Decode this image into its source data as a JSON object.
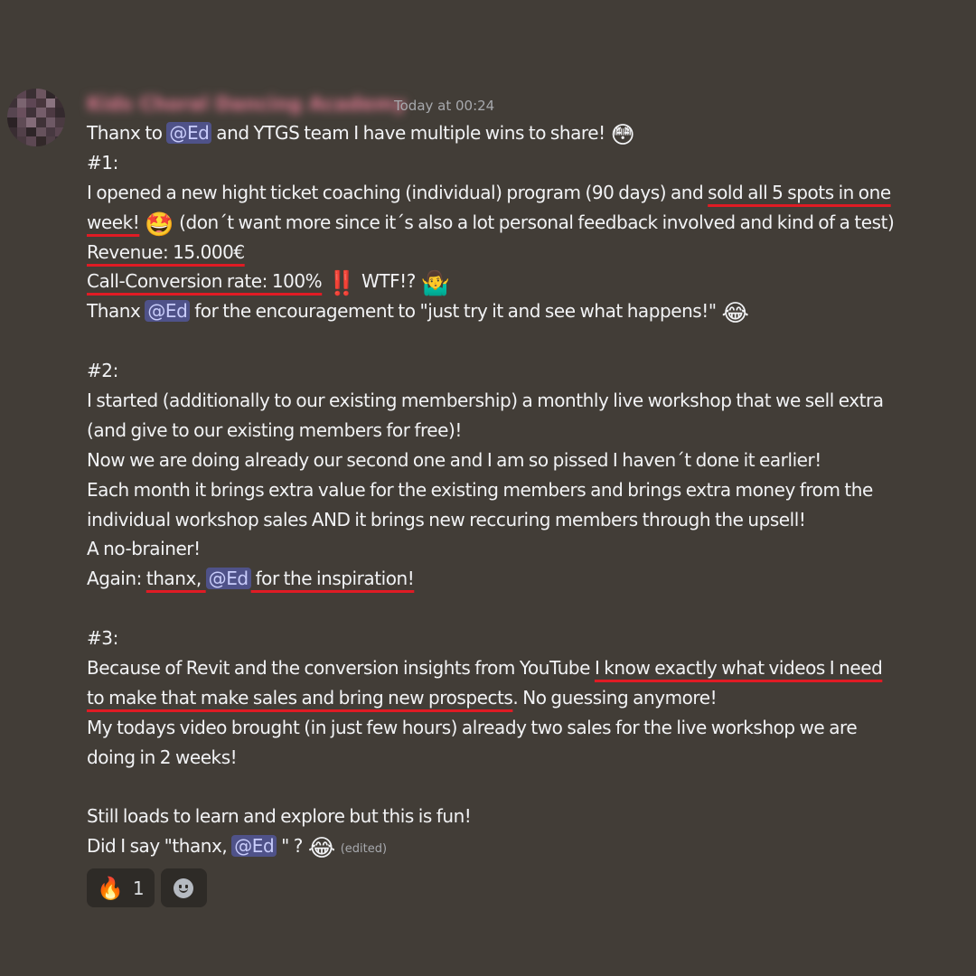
{
  "message": {
    "author": "Kids Choral Dancing Academy",
    "timestamp": "Today at 00:24",
    "lines": [
      [
        {
          "t": "Thanx to "
        },
        {
          "m": "@Ed"
        },
        {
          "t": " and YTGS team I have multiple wins to share! "
        },
        {
          "e": "😳"
        }
      ],
      [
        {
          "t": "#1:"
        }
      ],
      [
        {
          "t": "I opened a new hight ticket coaching (individual) program (90 days) and "
        },
        {
          "u": "sold all 5 spots in one"
        }
      ],
      [
        {
          "u": "week!"
        },
        {
          "t": " "
        },
        {
          "e": "🤩"
        },
        {
          "t": " (don´t want more since it´s also a lot personal feedback involved and kind of a test)"
        }
      ],
      [
        {
          "u": "Revenue: 15.000€"
        }
      ],
      [
        {
          "u": "Call-Conversion rate: 100%"
        },
        {
          "t": " "
        },
        {
          "e": "‼️"
        },
        {
          "t": " WTF!? "
        },
        {
          "e": "🤷‍♂️"
        }
      ],
      [
        {
          "t": "Thanx "
        },
        {
          "m": "@Ed"
        },
        {
          "t": " for the encouragement to \"just try it and see what happens!\" "
        },
        {
          "e": "😂"
        }
      ],
      [],
      [
        {
          "t": "#2:"
        }
      ],
      [
        {
          "t": "I started (additionally to our existing membership) a monthly live workshop that we sell extra"
        }
      ],
      [
        {
          "t": "(and give to our existing members for free)!"
        }
      ],
      [
        {
          "t": "Now we are doing already our second one and I am so pissed I haven´t done it earlier!"
        }
      ],
      [
        {
          "t": "Each month it brings extra value for the existing members and brings extra money from the"
        }
      ],
      [
        {
          "t": "individual workshop sales AND it brings new reccuring members through the upsell!"
        }
      ],
      [
        {
          "t": "A no-brainer!"
        }
      ],
      [
        {
          "t": "Again: "
        },
        {
          "u": "thanx, "
        },
        {
          "m": "@Ed"
        },
        {
          "u": " for the inspiration! "
        }
      ],
      [],
      [
        {
          "t": "#3:"
        }
      ],
      [
        {
          "t": "Because of Revit and the conversion insights from YouTube "
        },
        {
          "u": "I know exactly what videos I need"
        }
      ],
      [
        {
          "u": "to make that make sales and bring new prospects"
        },
        {
          "t": ". No guessing anymore!"
        }
      ],
      [
        {
          "t": "My todays video brought (in just few hours) already two sales for the live workshop we are"
        }
      ],
      [
        {
          "t": "doing in 2 weeks!"
        }
      ],
      [],
      [
        {
          "t": "Still loads to learn and explore but this is fun!"
        }
      ],
      [
        {
          "t": "Did I say \"thanx, "
        },
        {
          "m": "@Ed"
        },
        {
          "t": " \" ? "
        },
        {
          "e": "😂"
        },
        {
          "t": " "
        },
        {
          "x": "(edited)"
        }
      ]
    ]
  },
  "reactions": [
    {
      "emoji": "🔥",
      "count": "1"
    }
  ],
  "add_reaction_icon": "smile-icon",
  "colors": {
    "background": "#423d37",
    "mention_bg": "#4f5289",
    "mention_text": "#c9cdfb",
    "underline": "#e01b24",
    "username": "#e07a92",
    "reaction_bg": "#2e2b27"
  }
}
